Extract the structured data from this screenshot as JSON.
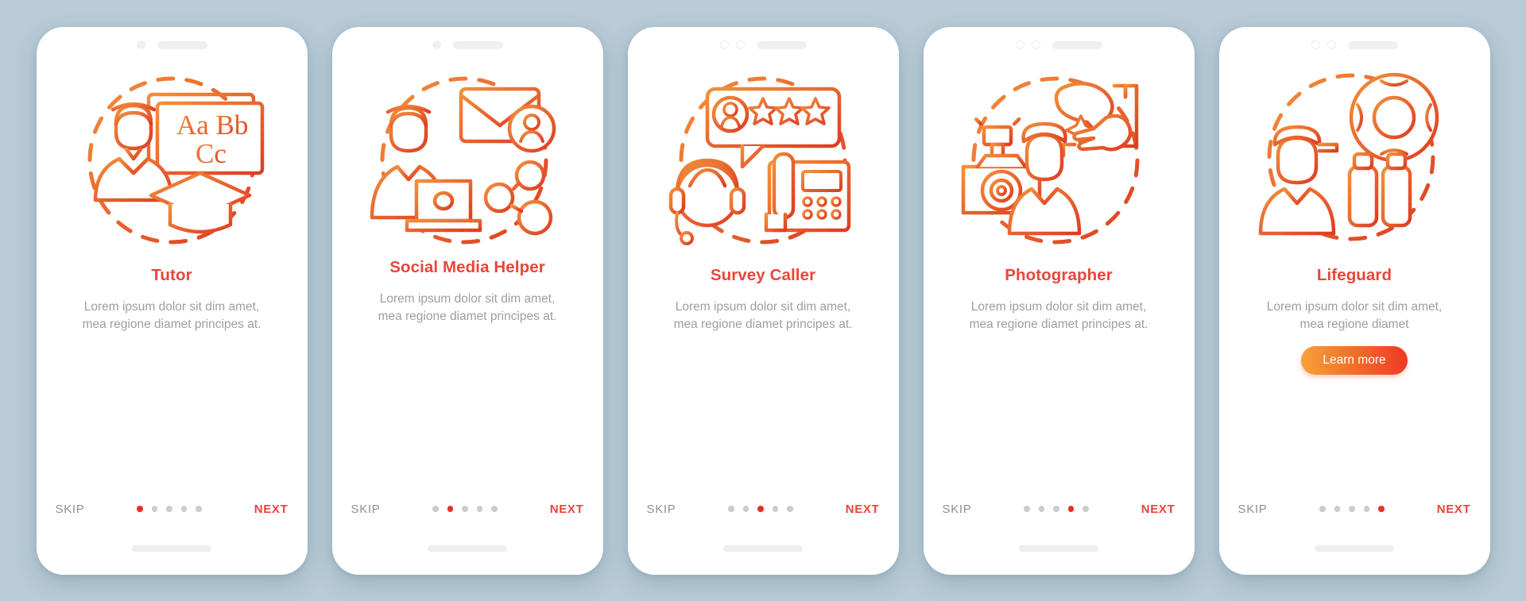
{
  "background_color": "#b8cbd6",
  "accent_color": "#e8463a",
  "muted_color": "#9b9fa4",
  "button_gradient": [
    "#f9a03a",
    "#ee3a24"
  ],
  "common": {
    "skip_label": "SKIP",
    "next_label": "NEXT",
    "description": "Lorem ipsum dolor sit dim amet, mea regione diamet principes at.",
    "total_dots": 5
  },
  "screens": [
    {
      "id": "tutor",
      "title": "Tutor",
      "description": "Lorem ipsum dolor sit dim amet, mea regione diamet principes at.",
      "illustration": "tutor-illustration",
      "notch_style": "single-dot",
      "active_dot": 1,
      "skip_label": "SKIP",
      "next_label": "NEXT",
      "learn_more": null
    },
    {
      "id": "social-media-helper",
      "title": "Social Media Helper",
      "description": "Lorem ipsum dolor sit dim amet, mea regione diamet principes at.",
      "illustration": "social-media-illustration",
      "notch_style": "single-dot",
      "active_dot": 2,
      "skip_label": "SKIP",
      "next_label": "NEXT",
      "learn_more": null
    },
    {
      "id": "survey-caller",
      "title": "Survey Caller",
      "description": "Lorem ipsum dolor sit dim amet, mea regione diamet principes at.",
      "illustration": "survey-caller-illustration",
      "notch_style": "two-rings",
      "active_dot": 3,
      "skip_label": "SKIP",
      "next_label": "NEXT",
      "learn_more": null
    },
    {
      "id": "photographer",
      "title": "Photographer",
      "description": "Lorem ipsum dolor sit dim amet, mea regione diamet principes at.",
      "illustration": "photographer-illustration",
      "notch_style": "two-rings",
      "active_dot": 4,
      "skip_label": "SKIP",
      "next_label": "NEXT",
      "learn_more": null
    },
    {
      "id": "lifeguard",
      "title": "Lifeguard",
      "description": "Lorem ipsum dolor sit dim amet, mea regione diamet",
      "illustration": "lifeguard-illustration",
      "notch_style": "two-rings",
      "active_dot": 5,
      "skip_label": "SKIP",
      "next_label": "NEXT",
      "learn_more": "Learn more"
    }
  ]
}
